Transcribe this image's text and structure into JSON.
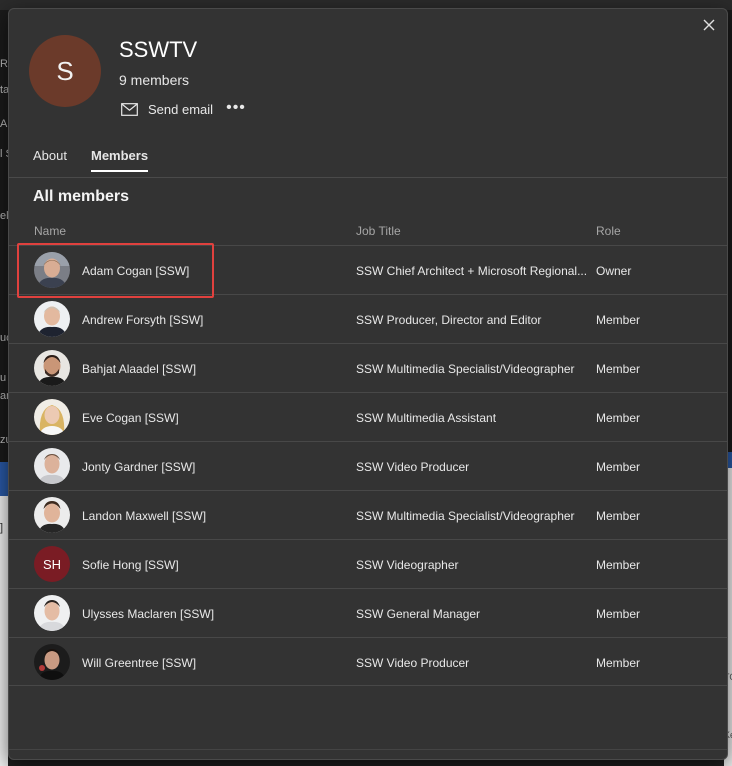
{
  "dialog": {
    "group_initial": "S",
    "group_name": "SSWTV",
    "member_count": "9 members",
    "send_email_label": "Send email",
    "more_label": "•••",
    "close_label": "✕"
  },
  "tabs": [
    {
      "label": "About",
      "active": false
    },
    {
      "label": "Members",
      "active": true
    }
  ],
  "section_title": "All members",
  "columns": {
    "name": "Name",
    "job": "Job Title",
    "role": "Role"
  },
  "members": [
    {
      "name": "Adam Cogan [SSW]",
      "job": "SSW Chief Architect + Microsoft Regional...",
      "role": "Owner",
      "avatar": "photo"
    },
    {
      "name": "Andrew Forsyth [SSW]",
      "job": "SSW Producer, Director and Editor",
      "role": "Member",
      "avatar": "photo"
    },
    {
      "name": "Bahjat Alaadel [SSW]",
      "job": "SSW Multimedia Specialist/Videographer",
      "role": "Member",
      "avatar": "photo"
    },
    {
      "name": "Eve Cogan [SSW]",
      "job": "SSW Multimedia Assistant",
      "role": "Member",
      "avatar": "photo"
    },
    {
      "name": "Jonty Gardner [SSW]",
      "job": "SSW Video Producer",
      "role": "Member",
      "avatar": "photo"
    },
    {
      "name": "Landon Maxwell [SSW]",
      "job": "SSW Multimedia Specialist/Videographer",
      "role": "Member",
      "avatar": "photo"
    },
    {
      "name": "Sofie Hong [SSW]",
      "job": "SSW Videographer",
      "role": "Member",
      "avatar": "initials",
      "initials": "SH"
    },
    {
      "name": "Ulysses Maclaren [SSW]",
      "job": "SSW General Manager",
      "role": "Member",
      "avatar": "photo"
    },
    {
      "name": "Will Greentree [SSW]",
      "job": "SSW Video Producer",
      "role": "Member",
      "avatar": "photo"
    }
  ],
  "colors": {
    "dialog_bg": "#333333",
    "group_avatar_bg": "#6b3a2a",
    "initials_avatar_bg": "#7a1c24",
    "highlight": "#e0413e"
  },
  "background_glyphs": [
    "R",
    "ta",
    "A",
    "l S",
    "el",
    "uc",
    "u",
    "ar",
    "zu",
    "]",
    "TO",
    "Ke"
  ]
}
